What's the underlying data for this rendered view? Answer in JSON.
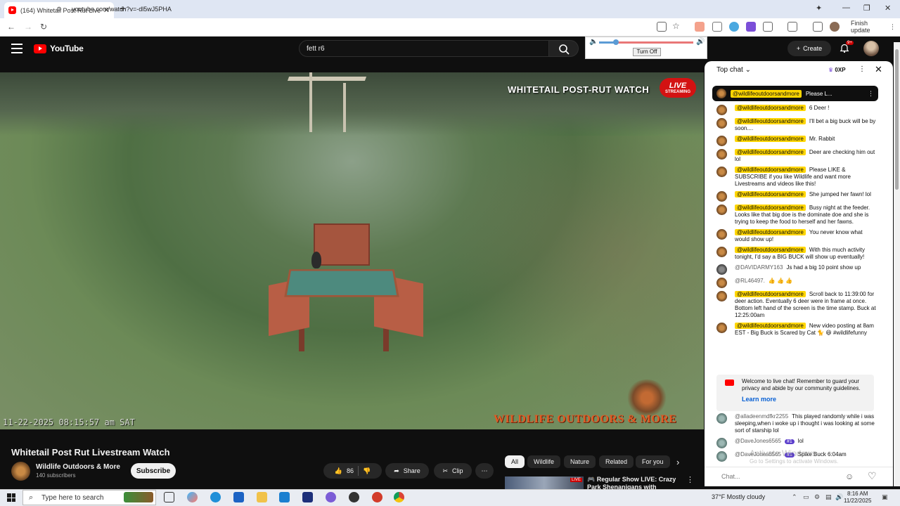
{
  "browser": {
    "tab_title": "(164) Whitetail Post Rut Live...",
    "new_tab": "+",
    "url": "youtube.com/watch?v=-dl5wJ5PHA",
    "finish_update": "Finish update",
    "win_min": "—",
    "win_max": "❐",
    "win_close": "✕"
  },
  "youtube": {
    "logo_text": "YouTube",
    "search_value": "fett r6",
    "volume_turn_off": "Turn Off",
    "volume_level": 0.18,
    "create_label": "Create",
    "notif_badge": "9+"
  },
  "video": {
    "overlay_title": "WHITETAIL POST-RUT WATCH",
    "live_label": "LIVE",
    "live_sub": "STREAMING",
    "timestamp": "11-22-2025 08:15:57 am SAT",
    "brand": "WILDLIFE OUTDOORS & MORE"
  },
  "below": {
    "title": "Whitetail Post Rut Livestream Watch",
    "channel_name": "Wildlife Outdoors & More",
    "subscribers": "140 subscribers",
    "subscribe_label": "Subscribe",
    "like_count": "86",
    "share_label": "Share",
    "clip_label": "Clip",
    "chips": [
      "All",
      "Wildlife",
      "Nature",
      "Related",
      "For you"
    ],
    "rec_title": "Regular Show LIVE: Crazy Park Shenanigans with",
    "rec_live": "LIVE"
  },
  "chat": {
    "top_chat": "Top chat",
    "xp": "0XP",
    "pinned_author": "@wildlifeoutdoorsandmore",
    "pinned_text": "Please L...",
    "messages": [
      {
        "author": "@wildlifeoutdoorsandmore",
        "text": "6 Deer !",
        "owner": true
      },
      {
        "author": "@wildlifeoutdoorsandmore",
        "text": "I'll bet a big buck will be by soon....",
        "owner": true
      },
      {
        "author": "@wildlifeoutdoorsandmore",
        "text": "Mr. Rabbit",
        "owner": true
      },
      {
        "author": "@wildlifeoutdoorsandmore",
        "text": "Deer are checking him out lol",
        "owner": true
      },
      {
        "author": "@wildlifeoutdoorsandmore",
        "text": "Please LIKE & SUBSCRIBE if you like Wildlife and want more Livestreams and videos like this!",
        "owner": true
      },
      {
        "author": "@wildlifeoutdoorsandmore",
        "text": "She jumped her fawn! lol",
        "owner": true
      },
      {
        "author": "@wildlifeoutdoorsandmore",
        "text": "Busy night at the feeder. Looks like that big doe is the dominate doe and she is trying to keep the food to herself and her fawns.",
        "owner": true
      },
      {
        "author": "@wildlifeoutdoorsandmore",
        "text": "You never know what would show up!",
        "owner": true
      },
      {
        "author": "@wildlifeoutdoorsandmore",
        "text": "With this much activity tonight, I'd say a BIG BUCK will show up eventually!",
        "owner": true
      },
      {
        "author": "@DAVIDARMY163",
        "text": "Js had a big 10 point show up",
        "owner": false,
        "avatar": "dark"
      },
      {
        "author": "@RL46497.",
        "text": "👍 👍 👍",
        "owner": false,
        "avatar": "brown"
      },
      {
        "author": "@wildlifeoutdoorsandmore",
        "text": "Scroll back to 11:39:00 for deer action. Eventually 6 deer were in frame at once. Bottom left hand of the screen is the time stamp. Buck at 12:25:00am",
        "owner": true
      },
      {
        "author": "@wildlifeoutdoorsandmore",
        "text": "New video posting at 8am EST - Big Buck is Scared by Cat 🐈 😆 #wildlifefunny",
        "owner": true
      }
    ],
    "welcome_text": "Welcome to live chat! Remember to guard your privacy and abide by our community guidelines.",
    "learn_more": "Learn more",
    "after_messages": [
      {
        "author": "@alladeenmdfkr2255",
        "text": "This played randomly while i was sleeping,when i woke up i thought i was looking at some sort of starship lol",
        "owner": false,
        "avatar": "gray"
      },
      {
        "author": "@DaveJones6565",
        "badge": "#1",
        "text": "lol",
        "owner": false,
        "avatar": "gray"
      },
      {
        "author": "@DaveJones6565",
        "badge": "#1",
        "text": "Spike Buck 6:04am",
        "owner": false,
        "avatar": "gray"
      }
    ],
    "input_placeholder": "Chat...",
    "watermark_title": "Activate Windows",
    "watermark_sub": "Go to Settings to activate Windows."
  },
  "taskbar": {
    "search_placeholder": "Type here to search",
    "weather": "37°F  Mostly cloudy",
    "time": "8:16 AM",
    "date": "11/22/2025"
  }
}
